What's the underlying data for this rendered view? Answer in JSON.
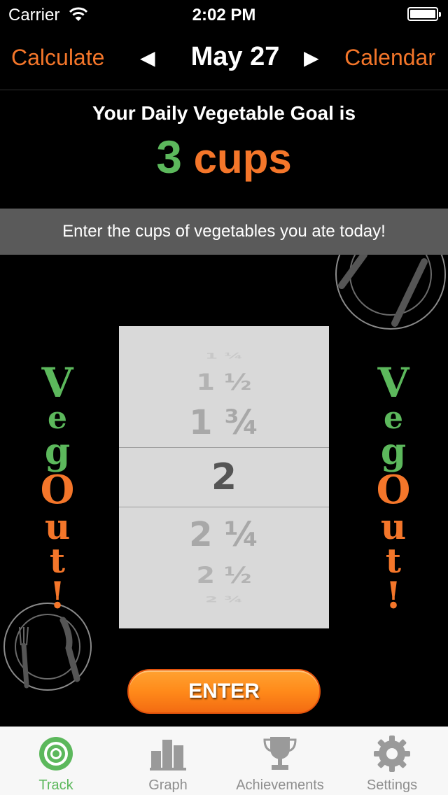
{
  "status_bar": {
    "carrier": "Carrier",
    "time": "2:02 PM"
  },
  "nav": {
    "left_label": "Calculate",
    "prev_arrow": "◀",
    "title": "May 27",
    "next_arrow": "▶",
    "right_label": "Calendar"
  },
  "goal": {
    "label": "Your Daily Vegetable Goal is",
    "number": "3",
    "unit": "cups"
  },
  "instruction": "Enter the cups of vegetables you ate today!",
  "picker": {
    "options": [
      "1 ¼",
      "1 ½",
      "1 ¾",
      "2",
      "2 ¼",
      "2 ½",
      "2 ¾"
    ],
    "selected": "2"
  },
  "side_text": {
    "letters": [
      "V",
      "e",
      "g",
      "O",
      "u",
      "t",
      "!"
    ]
  },
  "enter_button": "ENTER",
  "tabs": [
    {
      "label": "Track",
      "icon": "target-icon",
      "active": true
    },
    {
      "label": "Graph",
      "icon": "bar-chart-icon",
      "active": false
    },
    {
      "label": "Achievements",
      "icon": "trophy-icon",
      "active": false
    },
    {
      "label": "Settings",
      "icon": "gear-icon",
      "active": false
    }
  ],
  "colors": {
    "accent_orange": "#f4762a",
    "accent_green": "#5cb85c",
    "background": "#000000",
    "banner": "#5a5a5a",
    "picker_bg": "#d9d9d9"
  }
}
